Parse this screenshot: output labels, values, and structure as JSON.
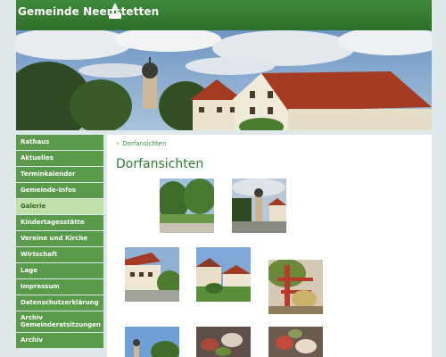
{
  "site": {
    "name": "Gemeinde Neenstetten"
  },
  "nav": {
    "items": [
      {
        "label": "Rathaus",
        "active": false
      },
      {
        "label": "Aktuelles",
        "active": false
      },
      {
        "label": "Terminkalender",
        "active": false
      },
      {
        "label": "Gemeinde-Infos",
        "active": false
      },
      {
        "label": "Galerie",
        "active": true
      },
      {
        "label": "Kindertagesstätte",
        "active": false
      },
      {
        "label": "Vereine und Kirche",
        "active": false
      },
      {
        "label": "Wirtschaft",
        "active": false
      },
      {
        "label": "Lage",
        "active": false
      },
      {
        "label": "Impressum",
        "active": false
      },
      {
        "label": "Datenschutzerklärung",
        "active": false
      },
      {
        "label": "Archiv Gemeinderatsitzungen",
        "active": false
      },
      {
        "label": "Archiv",
        "active": false
      }
    ]
  },
  "content": {
    "breadcrumb_sep": "»",
    "breadcrumb": "Dorfansichten",
    "title": "Dorfansichten"
  },
  "colors": {
    "header_green": "#2e6f2a",
    "nav_green": "#5a9a4b",
    "nav_active": "#bfe0a8",
    "accent_text": "#2f7a32"
  }
}
